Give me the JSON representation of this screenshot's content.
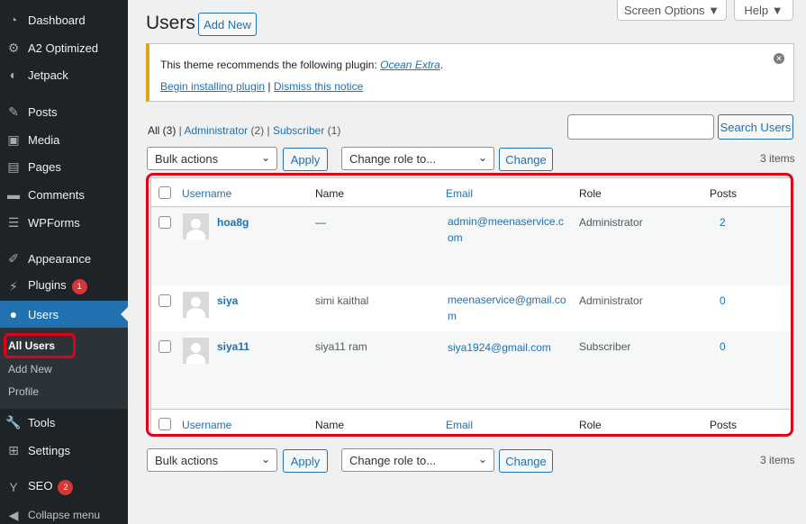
{
  "sidebar": {
    "items": [
      {
        "label": "Dashboard",
        "icon": "dashboard-icon"
      },
      {
        "label": "A2 Optimized",
        "icon": "gear-icon"
      },
      {
        "label": "Jetpack",
        "icon": "jetpack-icon"
      },
      {
        "label": "Posts",
        "icon": "pin-icon"
      },
      {
        "label": "Media",
        "icon": "media-icon"
      },
      {
        "label": "Pages",
        "icon": "pages-icon"
      },
      {
        "label": "Comments",
        "icon": "comment-icon"
      },
      {
        "label": "WPForms",
        "icon": "forms-icon"
      },
      {
        "label": "Appearance",
        "icon": "brush-icon"
      },
      {
        "label": "Plugins",
        "icon": "plugin-icon",
        "badge": "1"
      },
      {
        "label": "Users",
        "icon": "user-icon"
      },
      {
        "label": "Tools",
        "icon": "wrench-icon"
      },
      {
        "label": "Settings",
        "icon": "settings-icon"
      },
      {
        "label": "SEO",
        "icon": "yoast-icon",
        "badge": "2"
      },
      {
        "label": "Collapse menu",
        "icon": "collapse-icon"
      }
    ],
    "submenu": [
      "All Users",
      "Add New",
      "Profile"
    ]
  },
  "header": {
    "title": "Users",
    "add_new": "Add New",
    "screen_options": "Screen Options ▼",
    "help": "Help ▼"
  },
  "notice": {
    "text": "This theme recommends the following plugin: ",
    "plugin": "Ocean Extra",
    "after": ".",
    "begin": "Begin installing plugin",
    "separator": " | ",
    "dismiss": "Dismiss this notice"
  },
  "views": {
    "all": "All",
    "all_count": " (3)",
    "sep": " | ",
    "admin": "Administrator",
    "admin_count": " (2)",
    "subscriber": "Subscriber",
    "subscriber_count": " (1)"
  },
  "search": {
    "button": "Search Users"
  },
  "actions": {
    "bulk": "Bulk actions",
    "apply": "Apply",
    "role": "Change role to...",
    "change": "Change",
    "items": "3 items"
  },
  "table": {
    "columns": {
      "username": "Username",
      "name": "Name",
      "email": "Email",
      "role": "Role",
      "posts": "Posts"
    },
    "rows": [
      {
        "username": "hoa8g",
        "name": "—",
        "email": "admin@meenaservice.com",
        "role": "Administrator",
        "posts": "2"
      },
      {
        "username": "siya",
        "name": "simi kaithal",
        "email": "meenaservice@gmail.com",
        "role": "Administrator",
        "posts": "0"
      },
      {
        "username": "siya11",
        "name": "siya11 ram",
        "email": "siya1924@gmail.com",
        "role": "Subscriber",
        "posts": "0"
      }
    ]
  },
  "colors": {
    "accent": "#2271b1",
    "sidebar": "#1d2327",
    "highlight": "#e0001a",
    "notice": "#dba617"
  }
}
